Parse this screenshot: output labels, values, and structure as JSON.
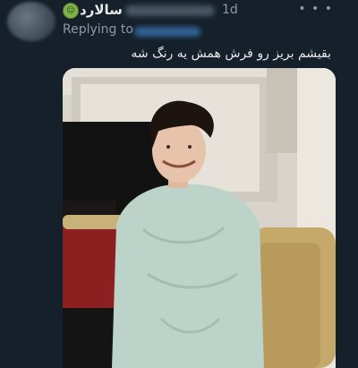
{
  "tweet": {
    "author_name": "سالارد",
    "time": "1d",
    "replying_to_label": "Replying to",
    "more_icon": "more-horizontal-icon",
    "text": "بقیشم بریز رو فرش همش یه رنگ شه"
  },
  "colors": {
    "background": "#15202b",
    "primary_text": "#e7e9ea",
    "secondary_text": "#8b98a5",
    "link": "#1d9bf0"
  }
}
